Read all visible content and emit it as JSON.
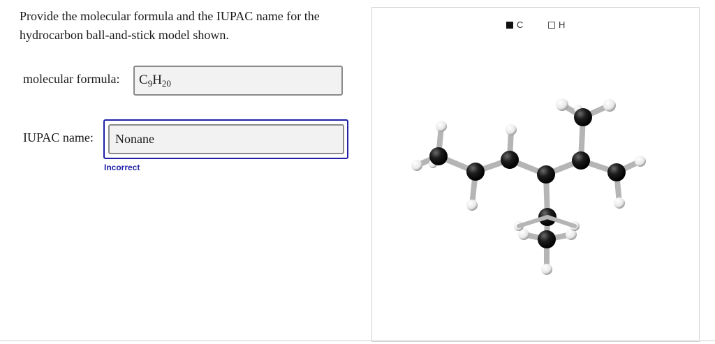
{
  "question": {
    "text": "Provide the molecular formula and the IUPAC name for the hydrocarbon ball-and-stick model shown."
  },
  "formula_row": {
    "label": "molecular formula:",
    "value": {
      "element1": "C",
      "count1": "9",
      "element2": "H",
      "count2": "20"
    }
  },
  "iupac_row": {
    "label": "IUPAC name:",
    "value": "Nonane",
    "feedback": "Incorrect"
  },
  "legend": {
    "carbon": "C",
    "hydrogen": "H"
  },
  "colors": {
    "accent": "#1f1fa8",
    "carbon": "#111111",
    "hydrogen": "#ffffff",
    "bond": "#b5b5b5"
  }
}
